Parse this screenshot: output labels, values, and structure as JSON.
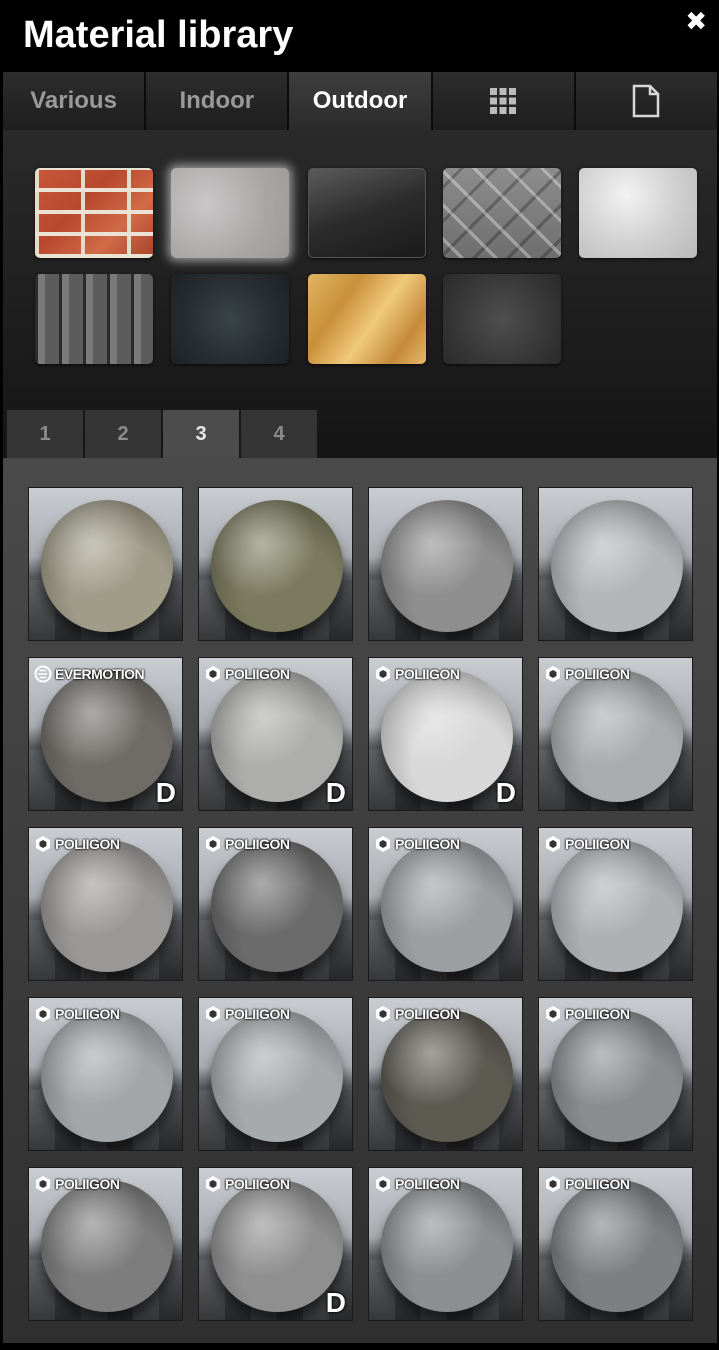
{
  "header": {
    "title": "Material library",
    "close_glyph": "✖"
  },
  "category_tabs": [
    {
      "label": "Various",
      "active": false
    },
    {
      "label": "Indoor",
      "active": false
    },
    {
      "label": "Outdoor",
      "active": true
    },
    {
      "label": "",
      "icon": "grid-icon",
      "active": false
    },
    {
      "label": "",
      "icon": "document-icon",
      "active": false
    }
  ],
  "swatches": [
    {
      "name": "brick",
      "selected": false
    },
    {
      "name": "concrete",
      "selected": true
    },
    {
      "name": "dark-glossy",
      "selected": false
    },
    {
      "name": "checker-plate",
      "selected": false
    },
    {
      "name": "plaster",
      "selected": false
    },
    {
      "name": "roof-tiles",
      "selected": false
    },
    {
      "name": "granite",
      "selected": false
    },
    {
      "name": "osb-wood",
      "selected": false
    },
    {
      "name": "asphalt",
      "selected": false
    }
  ],
  "pages": [
    {
      "label": "1",
      "active": false
    },
    {
      "label": "2",
      "active": false
    },
    {
      "label": "3",
      "active": true
    },
    {
      "label": "4",
      "active": false
    }
  ],
  "materials": [
    {
      "badge": "",
      "d": false,
      "color": "#a19c88"
    },
    {
      "badge": "",
      "d": false,
      "color": "#7b7a5e"
    },
    {
      "badge": "",
      "d": false,
      "color": "#8e8e8e"
    },
    {
      "badge": "",
      "d": false,
      "color": "#b3b6b9"
    },
    {
      "badge": "EVERMOTION",
      "d": true,
      "color": "#6f6c67"
    },
    {
      "badge": "POLIIGON",
      "d": true,
      "color": "#adadab"
    },
    {
      "badge": "POLIIGON",
      "d": true,
      "color": "#d8d8d8"
    },
    {
      "badge": "POLIIGON",
      "d": false,
      "color": "#a9abad"
    },
    {
      "badge": "POLIIGON",
      "d": false,
      "color": "#9a9896"
    },
    {
      "badge": "POLIIGON",
      "d": false,
      "color": "#6b6b6b"
    },
    {
      "badge": "POLIIGON",
      "d": false,
      "color": "#9c9fa2"
    },
    {
      "badge": "POLIIGON",
      "d": false,
      "color": "#aeb1b4"
    },
    {
      "badge": "POLIIGON",
      "d": false,
      "color": "#a3a6a9"
    },
    {
      "badge": "POLIIGON",
      "d": false,
      "color": "#a7aaad"
    },
    {
      "badge": "POLIIGON",
      "d": false,
      "color": "#5d5a52"
    },
    {
      "badge": "POLIIGON",
      "d": false,
      "color": "#8a8c8f"
    },
    {
      "badge": "POLIIGON",
      "d": false,
      "color": "#7d7d7d"
    },
    {
      "badge": "POLIIGON",
      "d": true,
      "color": "#8f8f8f"
    },
    {
      "badge": "POLIIGON",
      "d": false,
      "color": "#8c8e91"
    },
    {
      "badge": "POLIIGON",
      "d": false,
      "color": "#7d7f82"
    }
  ],
  "d_label": "D"
}
